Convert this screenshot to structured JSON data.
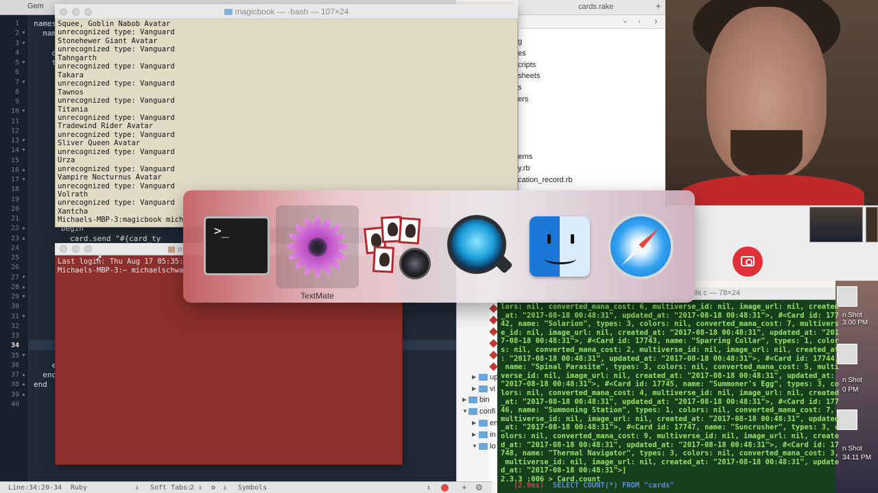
{
  "editor": {
    "tab_label": "Gem",
    "line_numbers": [
      "1",
      "2",
      "3",
      "4",
      "5",
      "6",
      "7",
      "8",
      "9",
      "10",
      "11",
      "12",
      "13",
      "14",
      "15",
      "16",
      "17",
      "18",
      "19",
      "20",
      "21",
      "22",
      "23",
      "24",
      "25",
      "26",
      "27",
      "28",
      "29",
      "30",
      "31",
      "32",
      "33",
      "34",
      "35",
      "36",
      "37",
      "38",
      "39",
      "40"
    ],
    "current_line": "34",
    "code_lines": [
      {
        "line": "1",
        "text": "names"
      },
      {
        "line": "2",
        "text": "  nam"
      },
      {
        "line": "4",
        "text": "    d"
      },
      {
        "line": "5",
        "text": "    t"
      },
      {
        "line": "22",
        "text": "      begin"
      },
      {
        "line": "23",
        "text": "        card.send \"#{card_ty"
      },
      {
        "line": "36",
        "text": "    e"
      },
      {
        "line": "37",
        "text": "  end"
      },
      {
        "line": "38",
        "text": "end"
      }
    ],
    "status": {
      "line": "Line:",
      "position": "34:20-34",
      "language": "Ruby",
      "soft_tabs": "Soft Tabs:",
      "tab_size": "2",
      "symbols": "Symbols"
    }
  },
  "finder": {
    "tab_label": "cards.rake",
    "items": [
      "g",
      "es",
      "cripts",
      "sheets",
      "s",
      "ers",
      "erns",
      "y.rb",
      "cation_record.rb"
    ]
  },
  "terminal1": {
    "title": "magicbook — -bash — 107×24",
    "lines": [
      "Squee, Goblin Nabob Avatar",
      "unrecognized type: Vanguard",
      "Stonehewer Giant Avatar",
      "unrecognized type: Vanguard",
      "Tahngarth",
      "unrecognized type: Vanguard",
      "Takara",
      "unrecognized type: Vanguard",
      "Tawnos",
      "unrecognized type: Vanguard",
      "Titania",
      "unrecognized type: Vanguard",
      "Tradewind Rider Avatar",
      "unrecognized type: Vanguard",
      "Sliver Queen Avatar",
      "unrecognized type: Vanguard",
      "Urza",
      "unrecognized type: Vanguard",
      "Vampire Nocturnus Avatar",
      "unrecognized type: Vanguard",
      "Volrath",
      "unrecognized type: Vanguard",
      "Xantcha",
      "Michaels-MBP-3:magicbook mich"
    ]
  },
  "terminal2": {
    "title": "mi",
    "lines": [
      "Last login: Thu Aug 17 05:35:",
      "Michaels-MBP-3:~ michaelschwa"
    ]
  },
  "terminal3": {
    "title": "ils c — 78×24",
    "lines": [
      "lors: nil, converted_mana_cost: 6, multiverse_id: nil, image_url: nil, created",
      "_at: \"2017-08-18 00:48:31\", updated_at: \"2017-08-18 00:48:31\">, #<Card id: 177",
      "42, name: \"Solarion\", types: 3, colors: nil, converted_mana_cost: 7, multivers",
      "e_id: nil, image_url: nil, created_at: \"2017-08-18 00:48:31\", updated_at: \"201",
      "7-08-18 00:48:31\">, #<Card id: 17743, name: \"Sparring Collar\", types: 1, color",
      "s: nil, converted_mana_cost: 2, multiverse_id: nil, image_url: nil, created_at",
      ": \"2017-08-18 00:48:31\", updated_at: \"2017-08-18 00:48:31\">, #<Card id: 17744,",
      " name: \"Spinal Parasite\", types: 3, colors: nil, converted_mana_cost: 5, multi",
      "verse_id: nil, image_url: nil, created_at: \"2017-08-18 00:48:31\", updated_at:",
      "\"2017-08-18 00:48:31\">, #<Card id: 17745, name: \"Summoner's Egg\", types: 3, co",
      "lors: nil, converted_mana_cost: 4, multiverse_id: nil, image_url: nil, created",
      "_at: \"2017-08-18 00:48:31\", updated_at: \"2017-08-18 00:48:31\">, #<Card id: 177",
      "46, name: \"Summoning Station\", types: 1, colors: nil, converted_mana_cost: 7,",
      "multiverse_id: nil, image_url: nil, created_at: \"2017-08-18 00:48:31\", updated",
      "_at: \"2017-08-18 00:48:31\">, #<Card id: 17747, name: \"Suncrusher\", types: 3, c",
      "olors: nil, converted_mana_cost: 9, multiverse_id: nil, image_url: nil, create",
      "d_at: \"2017-08-18 00:48:31\", updated_at: \"2017-08-18 00:48:31\">, #<Card id: 17",
      "748, name: \"Thermal Navigator\", types: 3, colors: nil, converted_mana_cost: 3,",
      " multiverse_id: nil, image_url: nil, created_at: \"2017-08-18 00:48:31\", update",
      "d_at: \"2017-08-18 00:48:31\">]",
      "2.3.3 :006 > Card.count"
    ],
    "sql_timing": "   (2.9ms)",
    "sql_query": "SELECT COUNT(*) FROM \"cards\""
  },
  "file_browser": {
    "items": [
      "up",
      "vi",
      "bin",
      "confi",
      "en",
      "in",
      "lo"
    ]
  },
  "desktop": {
    "labels": [
      "n Shot",
      "3.00 PM",
      "n Shot",
      "0 PM",
      "n Shot",
      "34.11 PM"
    ]
  },
  "app_switcher": {
    "apps": [
      {
        "name": "Terminal",
        "icon": "terminal-icon"
      },
      {
        "name": "TextMate",
        "icon": "textmate-icon"
      },
      {
        "name": "Photo Booth",
        "icon": "photo-booth-icon"
      },
      {
        "name": "QuickTime Player",
        "icon": "quicktime-icon"
      },
      {
        "name": "Finder",
        "icon": "finder-icon"
      },
      {
        "name": "Safari",
        "icon": "safari-icon"
      }
    ],
    "selected_label": "TextMate"
  },
  "colors": {
    "editor_bg": "#1f2a36",
    "terminal1_bg": "#e2dcc7",
    "terminal2_bg": "#8c2f2d",
    "terminal3_bg": "#163f1b",
    "terminal3_text": "#9be26a",
    "shutter": "#e0303a"
  }
}
